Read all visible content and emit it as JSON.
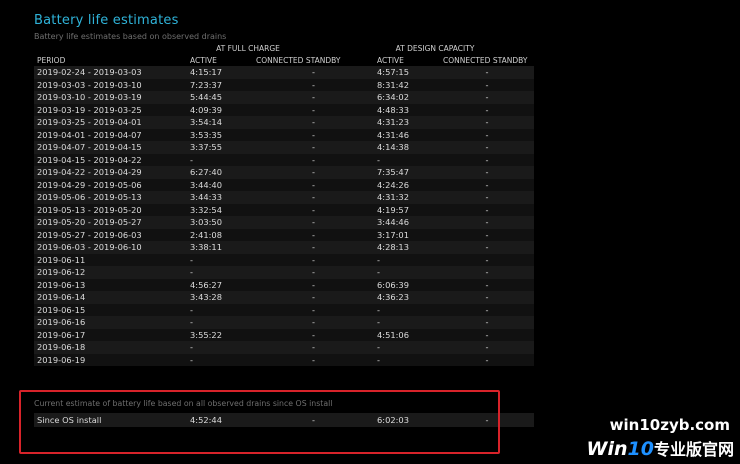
{
  "title": "Battery life estimates",
  "subtitle": "Battery life estimates based on observed drains",
  "groups": {
    "full": "AT FULL CHARGE",
    "design": "AT DESIGN CAPACITY"
  },
  "columns": [
    "PERIOD",
    "ACTIVE",
    "CONNECTED STANDBY",
    "ACTIVE",
    "CONNECTED STANDBY"
  ],
  "rows": [
    [
      "2019-02-24 - 2019-03-03",
      "4:15:17",
      "-",
      "4:57:15",
      "-"
    ],
    [
      "2019-03-03 - 2019-03-10",
      "7:23:37",
      "-",
      "8:31:42",
      "-"
    ],
    [
      "2019-03-10 - 2019-03-19",
      "5:44:45",
      "-",
      "6:34:02",
      "-"
    ],
    [
      "2019-03-19 - 2019-03-25",
      "4:09:39",
      "-",
      "4:48:33",
      "-"
    ],
    [
      "2019-03-25 - 2019-04-01",
      "3:54:14",
      "-",
      "4:31:23",
      "-"
    ],
    [
      "2019-04-01 - 2019-04-07",
      "3:53:35",
      "-",
      "4:31:46",
      "-"
    ],
    [
      "2019-04-07 - 2019-04-15",
      "3:37:55",
      "-",
      "4:14:38",
      "-"
    ],
    [
      "2019-04-15 - 2019-04-22",
      "-",
      "-",
      "-",
      "-"
    ],
    [
      "2019-04-22 - 2019-04-29",
      "6:27:40",
      "-",
      "7:35:47",
      "-"
    ],
    [
      "2019-04-29 - 2019-05-06",
      "3:44:40",
      "-",
      "4:24:26",
      "-"
    ],
    [
      "2019-05-06 - 2019-05-13",
      "3:44:33",
      "-",
      "4:31:32",
      "-"
    ],
    [
      "2019-05-13 - 2019-05-20",
      "3:32:54",
      "-",
      "4:19:57",
      "-"
    ],
    [
      "2019-05-20 - 2019-05-27",
      "3:03:50",
      "-",
      "3:44:46",
      "-"
    ],
    [
      "2019-05-27 - 2019-06-03",
      "2:41:08",
      "-",
      "3:17:01",
      "-"
    ],
    [
      "2019-06-03 - 2019-06-10",
      "3:38:11",
      "-",
      "4:28:13",
      "-"
    ],
    [
      "2019-06-11",
      "-",
      "-",
      "-",
      "-"
    ],
    [
      "2019-06-12",
      "-",
      "-",
      "-",
      "-"
    ],
    [
      "2019-06-13",
      "4:56:27",
      "-",
      "6:06:39",
      "-"
    ],
    [
      "2019-06-14",
      "3:43:28",
      "-",
      "4:36:23",
      "-"
    ],
    [
      "2019-06-15",
      "-",
      "-",
      "-",
      "-"
    ],
    [
      "2019-06-16",
      "-",
      "-",
      "-",
      "-"
    ],
    [
      "2019-06-17",
      "3:55:22",
      "-",
      "4:51:06",
      "-"
    ],
    [
      "2019-06-18",
      "-",
      "-",
      "-",
      "-"
    ],
    [
      "2019-06-19",
      "-",
      "-",
      "-",
      "-"
    ]
  ],
  "current": {
    "label": "Current estimate of battery life based on all observed drains since OS install",
    "row": [
      "Since OS install",
      "4:52:44",
      "-",
      "6:02:03",
      "-"
    ]
  },
  "watermark": {
    "url": "win10zyb.com",
    "logo_win": "Win",
    "logo_10": "10",
    "logo_cn": "专业版官网"
  },
  "colors": {
    "title": "#2fb3d9",
    "highlight": "#d8232a",
    "background": "#000000"
  }
}
